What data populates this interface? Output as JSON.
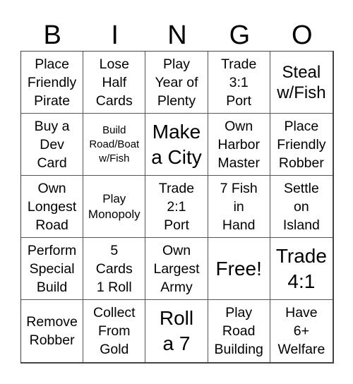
{
  "header": {
    "letters": [
      "B",
      "I",
      "N",
      "G",
      "O"
    ]
  },
  "cells": [
    "Place\nFriendly\nPirate",
    "Lose\nHalf\nCards",
    "Play\nYear of\nPlenty",
    "Trade\n3:1\nPort",
    "Steal\nw/Fish",
    "Buy a\nDev\nCard",
    "Build\nRoad/Boat\nw/Fish",
    "Make\na City",
    "Own\nHarbor\nMaster",
    "Place\nFriendly\nRobber",
    "Own\nLongest\nRoad",
    "Play\nMonopoly",
    "Trade\n2:1\nPort",
    "7 Fish\nin\nHand",
    "Settle\non\nIsland",
    "Perform\nSpecial\nBuild",
    "5\nCards\n1 Roll",
    "Own\nLargest\nArmy",
    "Free!",
    "Trade\n4:1",
    "Remove\nRobber",
    "Collect\nFrom\nGold",
    "Roll\na 7",
    "Play\nRoad\nBuilding",
    "Have\n6+\nWelfare"
  ]
}
